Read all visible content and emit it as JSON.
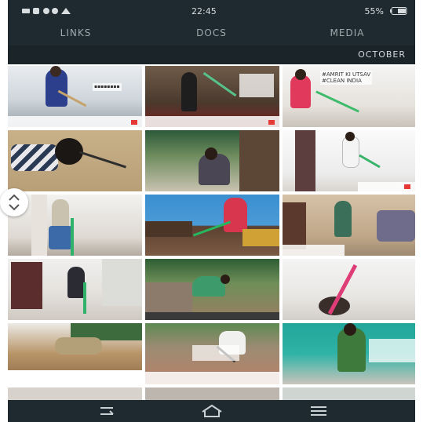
{
  "status_bar": {
    "time": "22:45",
    "battery": "55%",
    "signal_label": "4G"
  },
  "tabs": [
    {
      "label": "MEDIA",
      "active": true
    },
    {
      "label": "DOCS",
      "active": false
    },
    {
      "label": "LINKS",
      "active": false
    }
  ],
  "section": {
    "title": "OCTOBER"
  },
  "tiles": [
    {
      "caption": "#AMRIT KI UTSAV\n#CLEAN INDIA"
    },
    {
      "caption": ""
    },
    {
      "caption": ""
    },
    {
      "caption": ""
    },
    {
      "caption": ""
    },
    {
      "caption": ""
    },
    {
      "caption": ""
    },
    {
      "caption": ""
    },
    {
      "caption": ""
    },
    {
      "caption": ""
    },
    {
      "caption": ""
    },
    {
      "caption": ""
    },
    {
      "caption": ""
    },
    {
      "caption": ""
    },
    {
      "caption": ""
    }
  ],
  "icons": {
    "battery": "battery-icon",
    "wifi": "wifi-icon",
    "back": "back-icon",
    "home": "home-icon",
    "recents": "recents-icon",
    "scroll": "scroll-handle-icon"
  }
}
